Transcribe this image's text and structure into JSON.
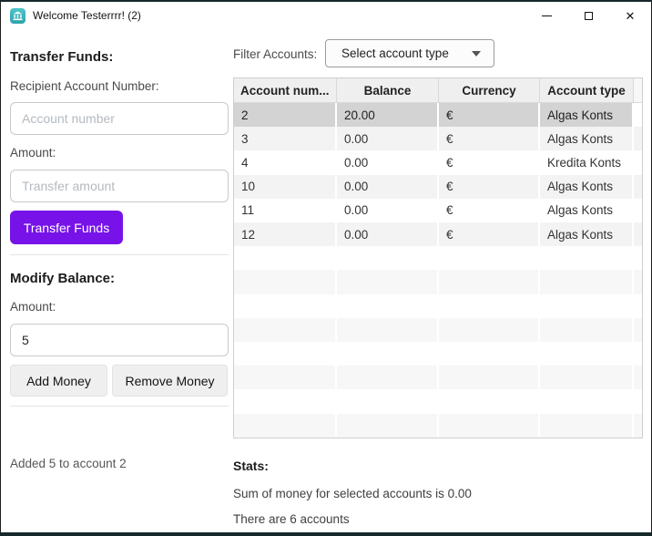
{
  "window": {
    "title": "Welcome Testerrrr! (2)"
  },
  "transfer": {
    "heading": "Transfer Funds:",
    "recipient_label": "Recipient Account Number:",
    "recipient_placeholder": "Account number",
    "amount_label": "Amount:",
    "amount_placeholder": "Transfer amount",
    "button_label": "Transfer Funds"
  },
  "modify": {
    "heading": "Modify Balance:",
    "amount_label": "Amount:",
    "amount_value": "5",
    "add_button_label": "Add Money",
    "remove_button_label": "Remove Money"
  },
  "status_message": "Added 5 to account 2",
  "filter": {
    "label": "Filter Accounts:",
    "dropdown_value": "Select account type"
  },
  "table": {
    "columns": [
      "Account num...",
      "Balance",
      "Currency",
      "Account type"
    ],
    "rows": [
      {
        "account": "2",
        "balance": "20.00",
        "currency": "€",
        "type": "Algas Konts",
        "selected": true
      },
      {
        "account": "3",
        "balance": "0.00",
        "currency": "€",
        "type": "Algas Konts",
        "selected": false
      },
      {
        "account": "4",
        "balance": "0.00",
        "currency": "€",
        "type": "Kredita Konts",
        "selected": false
      },
      {
        "account": "10",
        "balance": "0.00",
        "currency": "€",
        "type": "Algas Konts",
        "selected": false
      },
      {
        "account": "11",
        "balance": "0.00",
        "currency": "€",
        "type": "Algas Konts",
        "selected": false
      },
      {
        "account": "12",
        "balance": "0.00",
        "currency": "€",
        "type": "Algas Konts",
        "selected": false
      }
    ],
    "empty_row_count": 8
  },
  "stats": {
    "heading": "Stats:",
    "sum_line": "Sum of money for selected accounts is 0.00",
    "count_line": "There are 6 accounts"
  },
  "colors": {
    "accent_purple": "#7712e8",
    "app_icon_teal": "#3ab4bb",
    "selected_row_gray": "#d3d3d3"
  }
}
